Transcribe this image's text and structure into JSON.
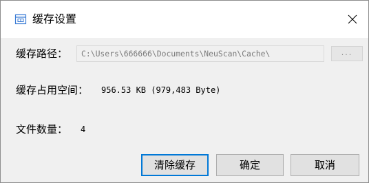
{
  "window": {
    "title": "缓存设置",
    "close_glyph": "✕"
  },
  "cache_path": {
    "label": "缓存路径：",
    "value": "C:\\Users\\666666\\Documents\\NeuScan\\Cache\\",
    "browse_label": "..."
  },
  "cache_size": {
    "label": "缓存占用空间：",
    "value": "956.53 KB (979,483 Byte)"
  },
  "file_count": {
    "label": "文件数量：",
    "value": "4"
  },
  "buttons": {
    "clear_label": "清除缓存",
    "ok_label": "确定",
    "cancel_label": "取消"
  },
  "colors": {
    "accent": "#0078d7",
    "window_bg": "#f0f0f0",
    "titlebar_bg": "#ffffff"
  },
  "icons": {
    "app": "dialog-window-icon",
    "close": "close-icon"
  }
}
